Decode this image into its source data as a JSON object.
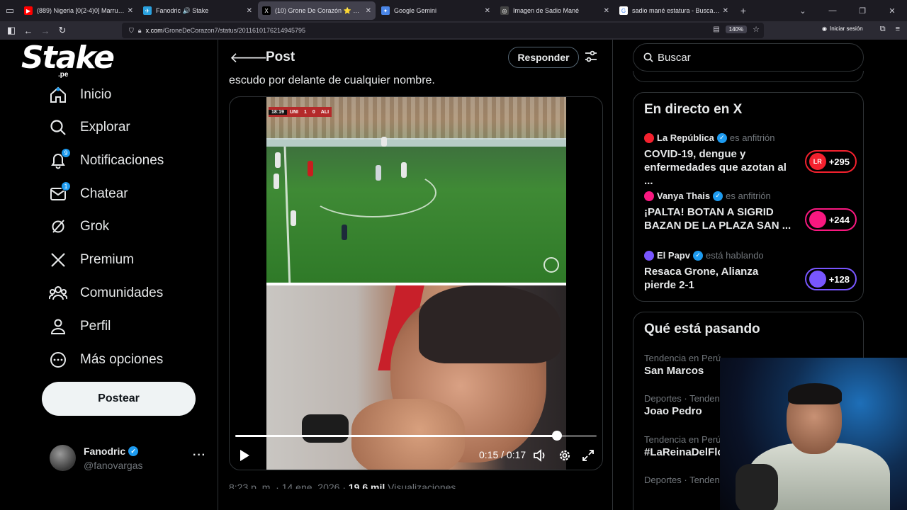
{
  "browser": {
    "tabs": [
      {
        "title": "(889) Nigeria [0(2-4)0] Marrueco",
        "color": "#ff0000",
        "glyph": "▶",
        "active": false
      },
      {
        "title": "Fanodric 🔊 Stake",
        "color": "#2aa1df",
        "glyph": "✈",
        "active": false
      },
      {
        "title": "(10) Grone De Corazón ⭐ ⭐ ⭐",
        "color": "#000000",
        "glyph": "X",
        "active": true
      },
      {
        "title": "Google Gemini",
        "color": "#4a86e8",
        "glyph": "✦",
        "active": false
      },
      {
        "title": "Imagen de Sadio Mané",
        "color": "#444444",
        "glyph": "◎",
        "active": false
      },
      {
        "title": "sadio mané estatura - Buscar co",
        "color": "#ffffff",
        "glyph": "G",
        "active": false
      }
    ],
    "url_domain": "x.com",
    "url_path": "/GroneDeCorazon7/status/2011610176214945795",
    "zoom": "140%",
    "signin_label": "Iniciar sesión"
  },
  "sidebar": {
    "logo_text": "Stake",
    "logo_sub": ".pe",
    "items": [
      {
        "label": "Inicio",
        "icon": "home-icon"
      },
      {
        "label": "Explorar",
        "icon": "search-icon"
      },
      {
        "label": "Notificaciones",
        "icon": "bell-icon",
        "badge": "9"
      },
      {
        "label": "Chatear",
        "icon": "mail-icon",
        "badge": "1"
      },
      {
        "label": "Grok",
        "icon": "grok-icon"
      },
      {
        "label": "Premium",
        "icon": "x-logo-icon"
      },
      {
        "label": "Comunidades",
        "icon": "communities-icon"
      },
      {
        "label": "Perfil",
        "icon": "profile-icon"
      },
      {
        "label": "Más opciones",
        "icon": "more-options-icon"
      }
    ],
    "post_button": "Postear",
    "account": {
      "name": "Fanodric",
      "handle": "@fanovargas",
      "more": "···"
    }
  },
  "post": {
    "title": "Post",
    "reply_label": "Responder",
    "text": "escudo por delante de cualquier nombre.",
    "video": {
      "scorebug": [
        "18:19",
        "UNI",
        "1",
        "0",
        "ALI"
      ],
      "current_time": "0:15",
      "duration": "0:17",
      "time_display": "0:15 / 0:17",
      "progress": 0.89
    },
    "meta": {
      "time": "8:23 p. m. · 14 ene. 2026 ·",
      "views": "19,6 mil",
      "views_label": "Visualizaciones"
    }
  },
  "right": {
    "search_placeholder": "Buscar",
    "live": {
      "title": "En directo en X",
      "spaces": [
        {
          "host": "La República",
          "role": "es anfitrión",
          "title": "COVID-19, dengue y enfermedades que azotan al ...",
          "count": "+295",
          "pill_color": "#f4212e",
          "avatar_text": "LR"
        },
        {
          "host": "Vanya Thais",
          "role": "es anfitrión",
          "title": "¡PALTA! BOTAN A SIGRID BAZAN DE LA PLAZA SAN ...",
          "count": "+244",
          "pill_color": "#f91880",
          "avatar_text": ""
        },
        {
          "host": "El Papv",
          "role": "está hablando",
          "title": "Resaca Grone, Alianza pierde 2-1",
          "count": "+128",
          "pill_color": "#7856ff",
          "avatar_text": ""
        }
      ]
    },
    "trends": {
      "title": "Qué está pasando",
      "items": [
        {
          "category": "Tendencia en Perú",
          "name": "San Marcos"
        },
        {
          "category": "Deportes · Tendencia",
          "name": "Joao Pedro"
        },
        {
          "category": "Tendencia en Perú",
          "name": "#LaReinaDelFlow"
        },
        {
          "category": "Deportes · Tendencia",
          "name": ""
        }
      ]
    }
  }
}
